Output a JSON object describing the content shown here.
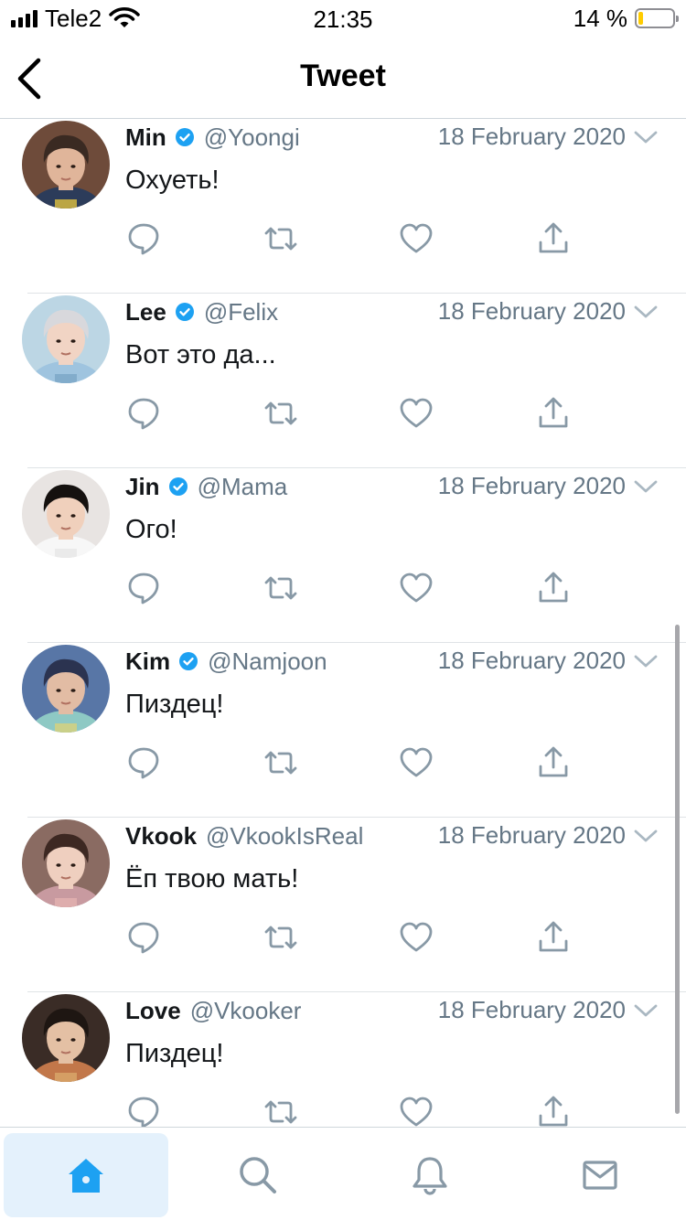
{
  "status_bar": {
    "carrier": "Tele2",
    "time": "21:35",
    "battery_percent_text": "14 %",
    "battery_level": 0.14,
    "battery_color": "#ffcc00"
  },
  "header": {
    "title": "Tweet",
    "back_icon": "chevron-left-icon"
  },
  "colors": {
    "accent": "#1da1f2",
    "icon_gray": "#8899a6",
    "secondary_text": "#657786",
    "active_tab_bg": "#e4f1fc"
  },
  "tweets": [
    {
      "name": "Min",
      "handle": "@Yoongi",
      "date": "18 February 2020",
      "text": "Охуеть!",
      "verified": true
    },
    {
      "name": "Lee",
      "handle": "@Felix",
      "date": "18 February 2020",
      "text": "Вот это да...",
      "verified": true
    },
    {
      "name": "Jin",
      "handle": "@Mama",
      "date": "18 February 2020",
      "text": "Ого!",
      "verified": true
    },
    {
      "name": "Kim",
      "handle": "@Namjoon",
      "date": "18 February 2020",
      "text": "Пиздец!",
      "verified": true
    },
    {
      "name": "Vkook",
      "handle": "@VkookIsReal",
      "date": "18 February 2020",
      "text": "Ёп твою мать!",
      "verified": false
    },
    {
      "name": "Love",
      "handle": "@Vkooker",
      "date": "18 February 2020",
      "text": "Пиздец!",
      "verified": false
    }
  ],
  "tweet_actions": [
    "reply-icon",
    "retweet-icon",
    "like-icon",
    "share-icon"
  ],
  "tab_bar": {
    "tabs": [
      {
        "icon": "home-icon",
        "active": true
      },
      {
        "icon": "search-icon",
        "active": false
      },
      {
        "icon": "notifications-bell-icon",
        "active": false
      },
      {
        "icon": "messages-envelope-icon",
        "active": false
      }
    ]
  }
}
